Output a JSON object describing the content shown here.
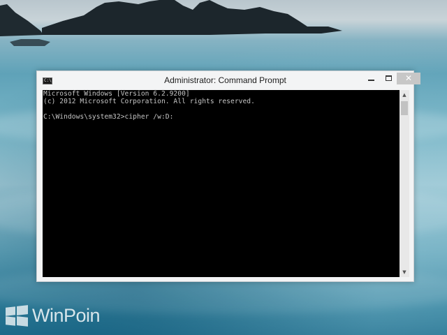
{
  "window": {
    "title": "Administrator: Command Prompt",
    "icon": "cmd-icon",
    "icon_glyph": "C:\\",
    "controls": {
      "minimize": "minimize-icon",
      "maximize": "maximize-icon",
      "close": "close-icon",
      "close_glyph": "✕"
    }
  },
  "console": {
    "lines": [
      "Microsoft Windows [Version 6.2.9200]",
      "(c) 2012 Microsoft Corporation. All rights reserved."
    ],
    "prompt": "C:\\Windows\\system32>cipher /w:D:"
  },
  "scrollbar": {
    "up_glyph": "▲",
    "down_glyph": "▼"
  },
  "watermark": {
    "text": "WinPoin"
  },
  "colors": {
    "console_bg": "#000000",
    "console_text": "#c6c6c6",
    "close_button": "#c7c7c7",
    "window_frame": "#f3f4f5"
  }
}
